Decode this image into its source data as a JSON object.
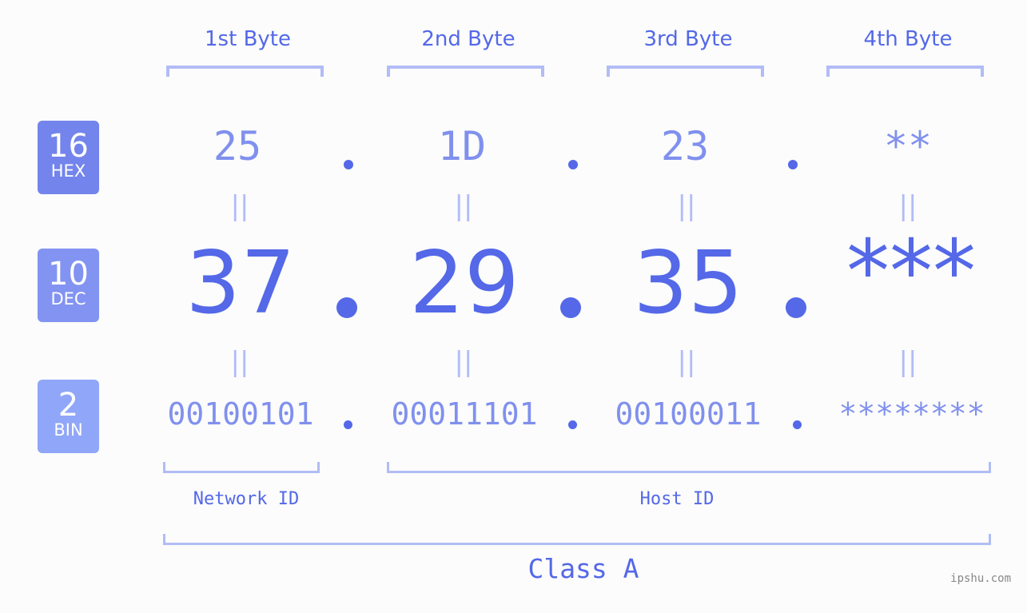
{
  "byte_headers": [
    "1st Byte",
    "2nd Byte",
    "3rd Byte",
    "4th Byte"
  ],
  "bases": [
    {
      "num": "16",
      "label": "HEX",
      "color": "#7384ec"
    },
    {
      "num": "10",
      "label": "DEC",
      "color": "#8293f2"
    },
    {
      "num": "2",
      "label": "BIN",
      "color": "#90a6f8"
    }
  ],
  "hex": [
    "25",
    "1D",
    "23",
    "**"
  ],
  "dec": [
    "37",
    "29",
    "35",
    "***"
  ],
  "bin": [
    "00100101",
    "00011101",
    "00100011",
    "********"
  ],
  "equals_symbol": "||",
  "network_label": "Network ID",
  "host_label": "Host ID",
  "class_label": "Class A",
  "watermark": "ipshu.com",
  "colors": {
    "accent": "#5468e8",
    "light": "#8090ee",
    "bracket": "#b2bcf6"
  }
}
